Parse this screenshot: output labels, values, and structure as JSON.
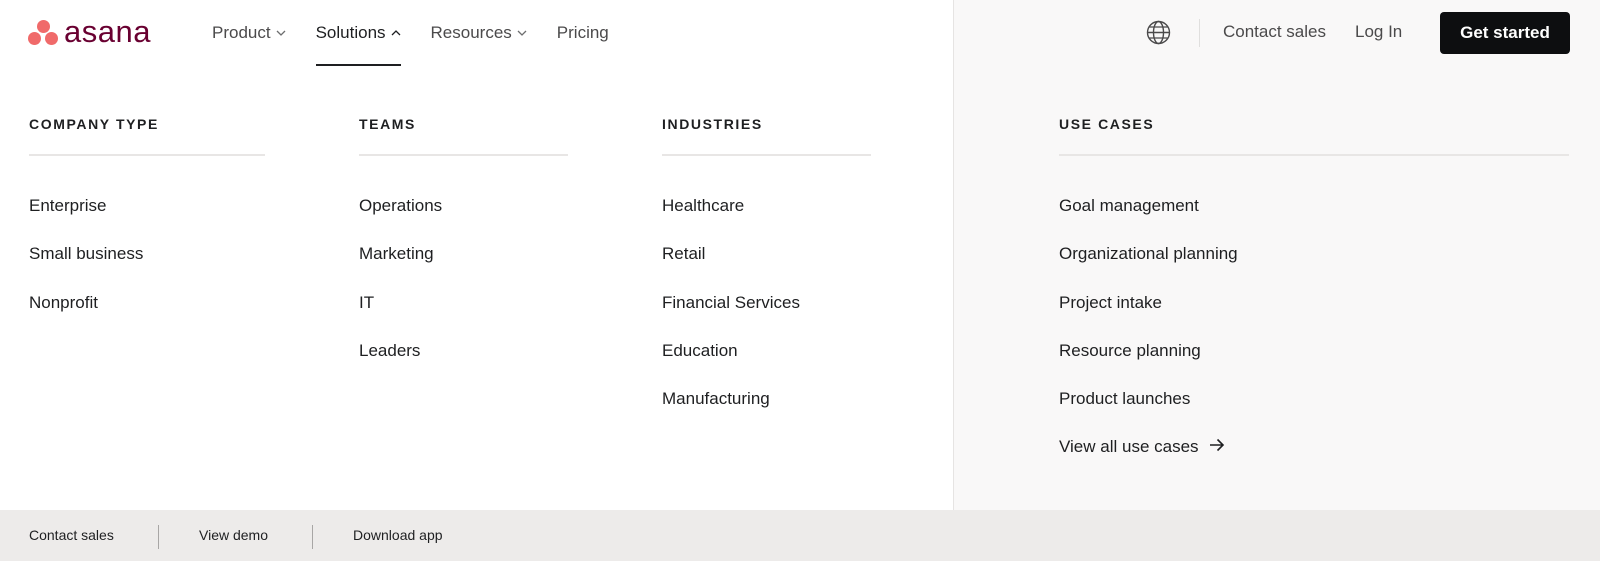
{
  "brand": {
    "name": "asana",
    "text_color": "#690031",
    "dot_color": "#f06a6a"
  },
  "nav": {
    "items": [
      {
        "label": "Product",
        "has_chevron": true,
        "active": false
      },
      {
        "label": "Solutions",
        "has_chevron": true,
        "active": true
      },
      {
        "label": "Resources",
        "has_chevron": true,
        "active": false
      },
      {
        "label": "Pricing",
        "has_chevron": false,
        "active": false
      }
    ],
    "contact_sales": "Contact sales",
    "log_in": "Log In",
    "get_started": "Get started",
    "language_icon": "globe-icon"
  },
  "menu": {
    "company_type": {
      "heading": "COMPANY TYPE",
      "items": [
        "Enterprise",
        "Small business",
        "Nonprofit"
      ]
    },
    "teams": {
      "heading": "TEAMS",
      "items": [
        "Operations",
        "Marketing",
        "IT",
        "Leaders"
      ]
    },
    "industries": {
      "heading": "INDUSTRIES",
      "items": [
        "Healthcare",
        "Retail",
        "Financial Services",
        "Education",
        "Manufacturing"
      ]
    },
    "use_cases": {
      "heading": "USE CASES",
      "items": [
        "Goal management",
        "Organizational planning",
        "Project intake",
        "Resource planning",
        "Product launches"
      ],
      "view_all": "View all use cases",
      "view_all_icon": "arrow-right-icon"
    }
  },
  "footer": {
    "contact_sales": "Contact sales",
    "view_demo": "View demo",
    "download_app": "Download app"
  }
}
